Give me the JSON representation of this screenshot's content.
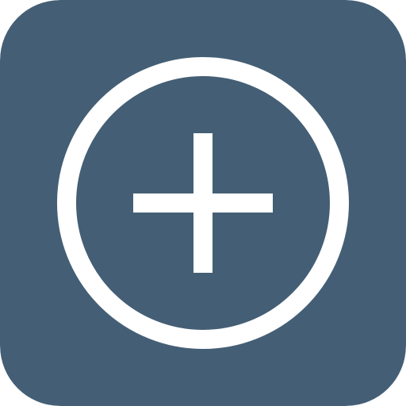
{
  "icon": {
    "name": "add-circle-icon",
    "background_color": "#445f75",
    "foreground_color": "#ffffff"
  }
}
